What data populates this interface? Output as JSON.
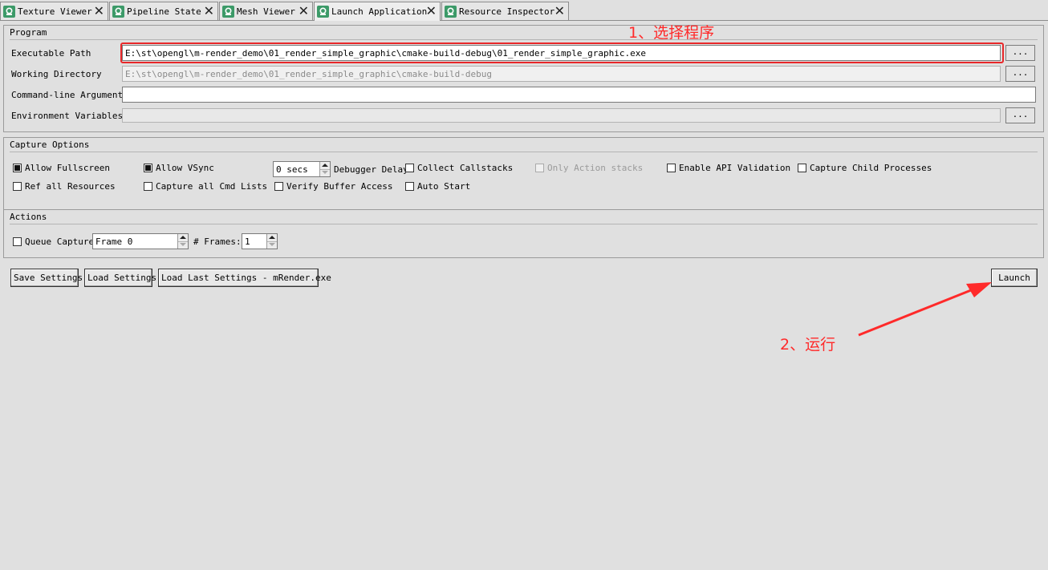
{
  "tabs": [
    {
      "label": "Texture Viewer",
      "icon": "camera-icon",
      "close": "✕"
    },
    {
      "label": "Pipeline State",
      "icon": "camera-icon",
      "close": "✕"
    },
    {
      "label": "Mesh Viewer",
      "icon": "camera-icon",
      "close": "✕"
    },
    {
      "label": "Launch Application",
      "icon": "camera-icon",
      "close": "✕"
    },
    {
      "label": "Resource Inspector",
      "icon": "camera-icon",
      "close": "✕"
    }
  ],
  "program": {
    "title": "Program",
    "executable_label": "Executable Path",
    "executable_value": "E:\\st\\opengl\\m-render_demo\\01_render_simple_graphic\\cmake-build-debug\\01_render_simple_graphic.exe",
    "workdir_label": "Working Directory",
    "workdir_placeholder": "E:\\st\\opengl\\m-render_demo\\01_render_simple_graphic\\cmake-build-debug",
    "args_label": "Command-line Arguments",
    "args_value": "",
    "env_label": "Environment Variables",
    "env_value": "",
    "browse_label": "..."
  },
  "capture": {
    "title": "Capture Options",
    "allow_fullscreen": {
      "label": "Allow Fullscreen",
      "checked": true
    },
    "allow_vsync": {
      "label": "Allow VSync",
      "checked": true
    },
    "debugger_delay_value": "0 secs",
    "debugger_delay_label": "Debugger Delay",
    "collect_callstacks": {
      "label": "Collect Callstacks",
      "checked": false
    },
    "only_action_stacks": {
      "label": "Only Action stacks",
      "checked": false,
      "enabled": false
    },
    "enable_api_validation": {
      "label": "Enable API Validation",
      "checked": false
    },
    "capture_child_processes": {
      "label": "Capture Child Processes",
      "checked": false
    },
    "ref_all_resources": {
      "label": "Ref all Resources",
      "checked": false
    },
    "capture_all_cmd_lists": {
      "label": "Capture all Cmd Lists",
      "checked": false
    },
    "verify_buffer_access": {
      "label": "Verify Buffer Access",
      "checked": false
    },
    "auto_start": {
      "label": "Auto Start",
      "checked": false
    }
  },
  "actions": {
    "title": "Actions",
    "queue_capture": {
      "label": "Queue Capture",
      "checked": false
    },
    "frame_value": "Frame 0",
    "frames_label": "# Frames:",
    "frames_value": "1"
  },
  "buttons": {
    "save": "Save Settings",
    "load": "Load Settings",
    "load_last": "Load Last Settings - mRender.exe",
    "launch": "Launch"
  },
  "annotations": {
    "step1": "1、选择程序",
    "step2": "2、运行",
    "color": "#ff2a2a"
  }
}
